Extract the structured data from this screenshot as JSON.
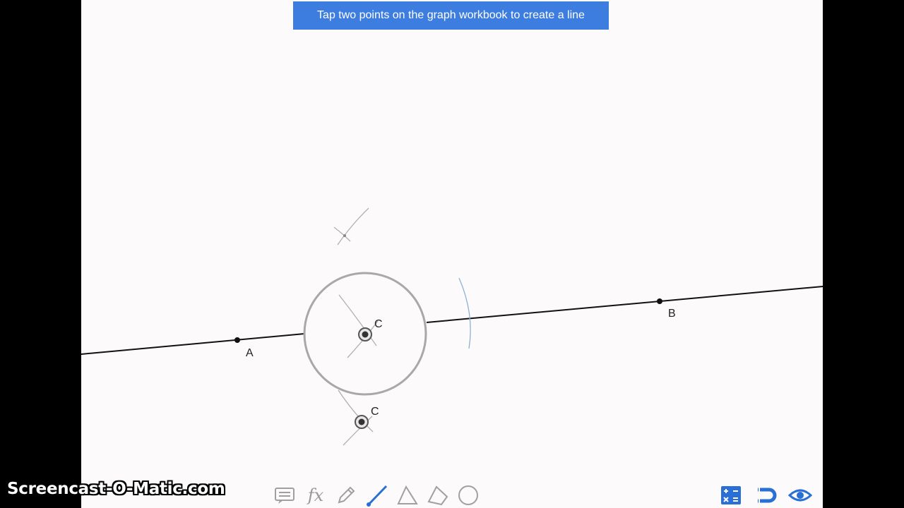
{
  "banner": {
    "text": "Tap two points on the graph workbook to create a line"
  },
  "points": {
    "a_label": "A",
    "b_label": "B",
    "c_label_upper": "C",
    "c_label_lower": "C"
  },
  "toolbar": {
    "fx_label": "fx",
    "icons": [
      "menu-icon",
      "comment-icon",
      "fx-icon",
      "pencil-icon",
      "line-tool-icon",
      "triangle-icon",
      "polygon-icon",
      "circle-icon",
      "calculator-icon",
      "magnet-icon",
      "eye-icon"
    ]
  },
  "watermark": {
    "text": "Screencast-O-Matic.com"
  },
  "colors": {
    "banner": "#3d7de0",
    "canvas": "#fcfafa",
    "line": "#111111",
    "construction": "#9a9a9a",
    "toolbar_active": "#2a6fd6",
    "toolbar_icon": "#a0a0a0"
  }
}
